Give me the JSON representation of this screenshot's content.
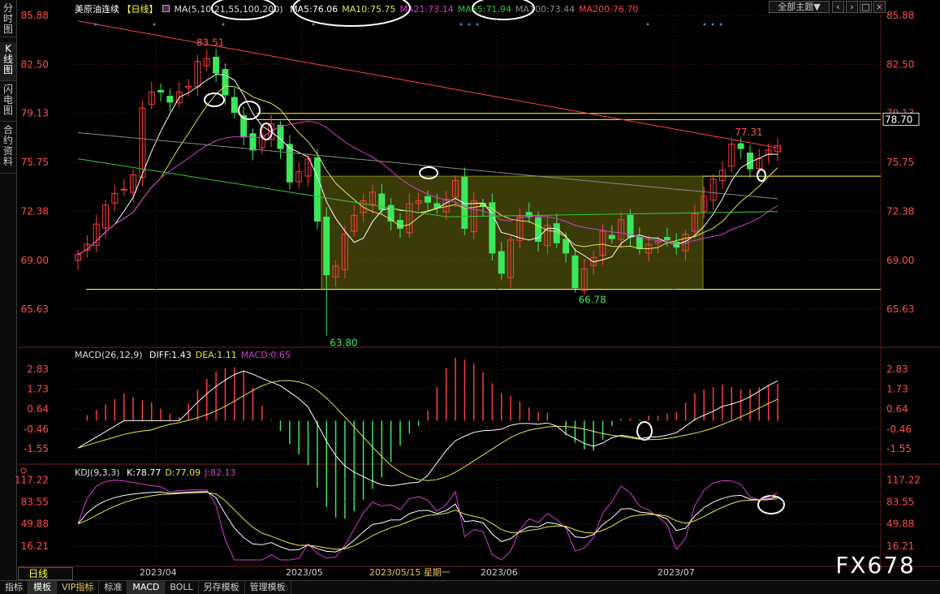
{
  "sidebar": {
    "tabs": [
      {
        "label": "分时图",
        "active": false
      },
      {
        "label": "K线图",
        "active": true
      },
      {
        "label": "闪电图",
        "active": false
      },
      {
        "label": "合约资料",
        "active": false
      }
    ]
  },
  "header": {
    "instrument": "美原油连续",
    "period_tag": "【日线】",
    "ma_label": "MA(5,10,21,55,100,200)",
    "ma_values": [
      {
        "text": "MA5:76.06",
        "color": "#ffffff"
      },
      {
        "text": "MA10:75.75",
        "color": "#e6e64a"
      },
      {
        "text": "MA21:73.14",
        "color": "#d33cd3"
      },
      {
        "text": "MA55:71.94",
        "color": "#32c832"
      },
      {
        "text": "MA100:73.44",
        "color": "#8a8a8a"
      },
      {
        "text": "MA200:76.70",
        "color": "#ff4040"
      }
    ],
    "theme_button": "全部主题▼"
  },
  "colors": {
    "up": "#ff3c3c",
    "down": "#3ce85a",
    "axis_up": "#ff4d4d",
    "grid": "#5a1a1a",
    "yellow": "#ffff40"
  },
  "chart_data": [
    {
      "type": "candlestick",
      "title": "美原油连续【日线】",
      "y_ticks": [
        "85.88",
        "82.50",
        "79.13",
        "75.75",
        "72.38",
        "69.00",
        "65.63"
      ],
      "ylim": [
        63.0,
        86.5
      ],
      "x_ticks": [
        "2023/04",
        "2023/05",
        "2023/06",
        "2023/07"
      ],
      "cursor_date": "2023/05/15 星期一",
      "annotations": [
        {
          "text": "83.51",
          "value": 83.51
        },
        {
          "text": "63.80",
          "value": 63.8
        },
        {
          "text": "66.78",
          "value": 66.78
        },
        {
          "text": "77.31",
          "value": 77.31
        }
      ],
      "hlines": [
        {
          "value": 79.13,
          "label": ""
        },
        {
          "value": 78.7,
          "label": "78.70"
        },
        {
          "value": 74.8,
          "label": ""
        },
        {
          "value": 67.0,
          "label": ""
        }
      ],
      "range_box": {
        "y_low": 67.0,
        "y_high": 74.8
      },
      "close": [
        69.4,
        70.1,
        71.5,
        72.8,
        73.6,
        73.9,
        74.9,
        79.5,
        80.6,
        80.6,
        79.9,
        80.6,
        81.0,
        82.7,
        82.9,
        81.9,
        80.4,
        79.2,
        77.5,
        76.6,
        77.6,
        78.4,
        76.7,
        74.4,
        75.1,
        76.0,
        71.7,
        68.0,
        68.6,
        70.8,
        72.1,
        73.1,
        73.7,
        72.5,
        71.7,
        71.2,
        72.9,
        73.1,
        73.0,
        72.6,
        73.2,
        74.5,
        71.2,
        73.1,
        72.7,
        69.5,
        68.1,
        70.4,
        72.0,
        72.0,
        70.3,
        71.4,
        70.2,
        69.5,
        67.1,
        68.4,
        69.2,
        71.0,
        70.5,
        71.8,
        70.6,
        69.8,
        70.1,
        70.3,
        70.4,
        69.9,
        70.8,
        72.2,
        73.4,
        74.6,
        75.2,
        77.0,
        76.7,
        75.3,
        76.0,
        76.6,
        76.9
      ],
      "series": [
        {
          "name": "MA5",
          "color": "#ffffff"
        },
        {
          "name": "MA10",
          "color": "#e6e64a"
        },
        {
          "name": "MA21",
          "color": "#d33cd3"
        },
        {
          "name": "MA55",
          "color": "#32c832"
        },
        {
          "name": "MA100",
          "color": "#8a8a8a"
        },
        {
          "name": "MA200",
          "color": "#ff4040"
        }
      ]
    },
    {
      "type": "macd",
      "label": "MACD(26,12,9)",
      "values_text": [
        {
          "text": "DIFF:1.43",
          "color": "#ffffff"
        },
        {
          "text": "DEA:1.11",
          "color": "#e6e64a"
        },
        {
          "text": "MACD:0.65",
          "color": "#d33cd3"
        }
      ],
      "y_ticks": [
        "2.83",
        "1.73",
        "0.64",
        "-0.46",
        "-1.55"
      ],
      "ylim": [
        -2.3,
        3.5
      ]
    },
    {
      "type": "kdj",
      "label": "KDJ(9,3,3)",
      "values_text": [
        {
          "text": "K:78.77",
          "color": "#ffffff"
        },
        {
          "text": "D:77.09",
          "color": "#e6e64a"
        },
        {
          "text": "J:82.13",
          "color": "#d33cd3"
        }
      ],
      "y_ticks": [
        "117.22",
        "83.55",
        "49.88",
        "16.21"
      ],
      "ylim": [
        -5,
        125
      ]
    }
  ],
  "footer": {
    "period_label": "日线",
    "tabs": [
      {
        "label": "指标",
        "selected": false,
        "vip": false
      },
      {
        "label": "模板",
        "selected": true,
        "vip": false
      },
      {
        "label": "VIP指标",
        "selected": false,
        "vip": true
      },
      {
        "label": "标准",
        "selected": false,
        "vip": false
      },
      {
        "label": "MACD",
        "selected": true,
        "vip": false
      },
      {
        "label": "BOLL",
        "selected": false,
        "vip": false
      },
      {
        "label": "另存模板",
        "selected": false,
        "vip": false
      },
      {
        "label": "管理模板",
        "selected": false,
        "vip": false
      }
    ]
  },
  "watermark": "FX678"
}
